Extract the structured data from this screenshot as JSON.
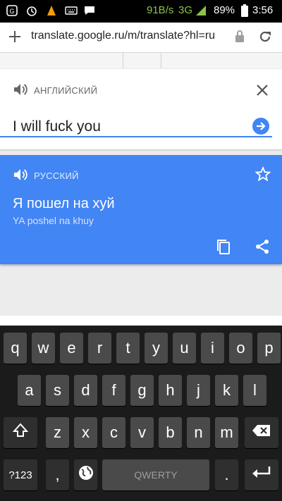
{
  "status_bar": {
    "network_speed": "91B/s",
    "network_type": "3G",
    "battery": "89%",
    "time": "3:56",
    "icons": [
      "maps-notification-icon",
      "alarm-icon",
      "vlc-icon",
      "keyboard-icon",
      "message-icon"
    ]
  },
  "browser": {
    "url": "translate.google.ru/m/translate?hl=ru"
  },
  "source": {
    "language": "АНГЛИЙСКИЙ",
    "text": "I will fuck you"
  },
  "result": {
    "language": "РУССКИЙ",
    "text": "Я пошел на хуй",
    "transliteration": "YA poshel na khuy"
  },
  "keyboard": {
    "row1": [
      "q",
      "w",
      "e",
      "r",
      "t",
      "y",
      "u",
      "i",
      "o",
      "p"
    ],
    "row2": [
      "a",
      "s",
      "d",
      "f",
      "g",
      "h",
      "j",
      "k",
      "l"
    ],
    "row3": [
      "z",
      "x",
      "c",
      "v",
      "b",
      "n",
      "m"
    ],
    "symbols_label": "?123",
    "comma_label": ",",
    "space_label": "QWERTY",
    "period_label": "."
  },
  "colors": {
    "accent": "#4285f4",
    "keyboard_bg": "#1b1b1b",
    "key_bg": "#4a4a4a"
  }
}
